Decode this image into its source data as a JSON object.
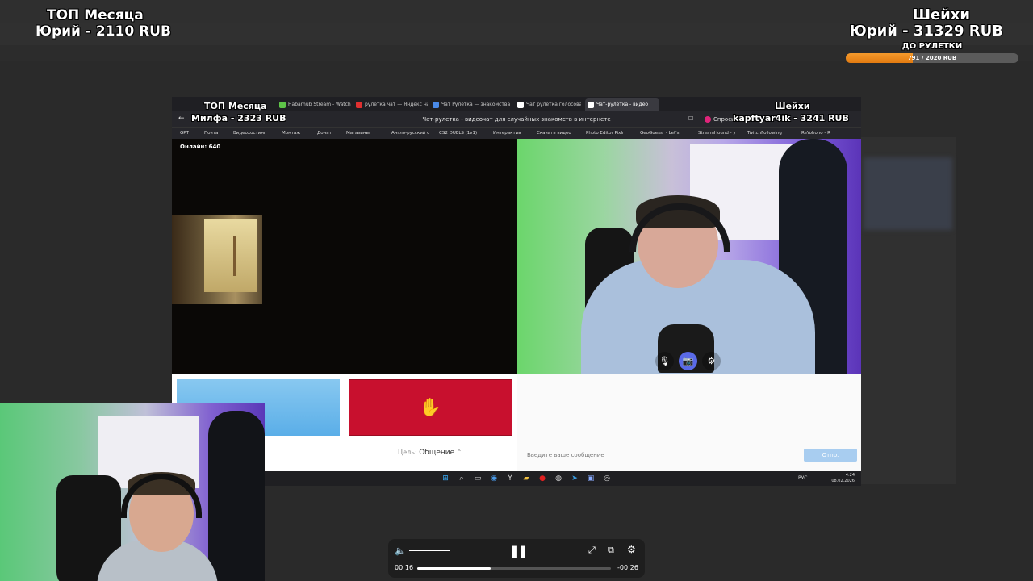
{
  "overlay_top_left": {
    "title": "ТОП Месяца",
    "value": "Юрий - 2110 RUB"
  },
  "overlay_top_right": {
    "title": "Шейхи",
    "value": "Юрий - 31329 RUB",
    "progress_label": "ДО РУЛЕТКИ",
    "progress_text": "791 / 2020 RUB",
    "progress_fraction": 0.39
  },
  "inner_overlay": {
    "left_title": "ТОП Месяца",
    "left_value": "Милфа - 2323 RUB",
    "right_title": "Шейхи",
    "right_value": "kapftyar4ik - 3241 RUB"
  },
  "browser": {
    "tabs": [
      {
        "label": "Habarhub Stream - Watch",
        "color": "#5ec448",
        "active": false
      },
      {
        "label": "рулетка чат — Яндекс нашлось",
        "color": "#e03030",
        "active": false
      },
      {
        "label": "Чат Рулетка — знакомства",
        "color": "#4a8ae8",
        "active": false
      },
      {
        "label": "Чат рулетка голосовая",
        "color": "#ffffff",
        "active": false
      },
      {
        "label": "Чат-рулетка - видео",
        "color": "#ffffff",
        "active": true
      }
    ],
    "page_title": "Чат-рулетка - видеочат для случайных знакомств в интернете",
    "ask_label": "Спросить",
    "bookmarks": [
      "GPT",
      "Почта",
      "Видеохостинг",
      "Монтаж",
      "Донат",
      "Магазины",
      "Англо-русский с",
      "CS2 DUELS (1v1)",
      "Интерактив",
      "Скачать видео",
      "Photo Editor Pixlr",
      "GeoGuessr - Let's",
      "StreamHound - y",
      "TwitchFollowing",
      "ReYohoho - R"
    ]
  },
  "video_left": {
    "online_label": "Онлайн: 640"
  },
  "controls": {
    "stop_icon": "hand-icon",
    "goal_label": "Цель:",
    "goal_value": "Общение",
    "chat_placeholder": "Введите ваше сообщение",
    "send_label": "Отпр."
  },
  "taskbar": {
    "lang": "РУС",
    "time": "4:24",
    "date": "08.02.2026"
  },
  "player": {
    "current_time": "00:16",
    "remaining_time": "-00:26",
    "progress_fraction": 0.38
  }
}
